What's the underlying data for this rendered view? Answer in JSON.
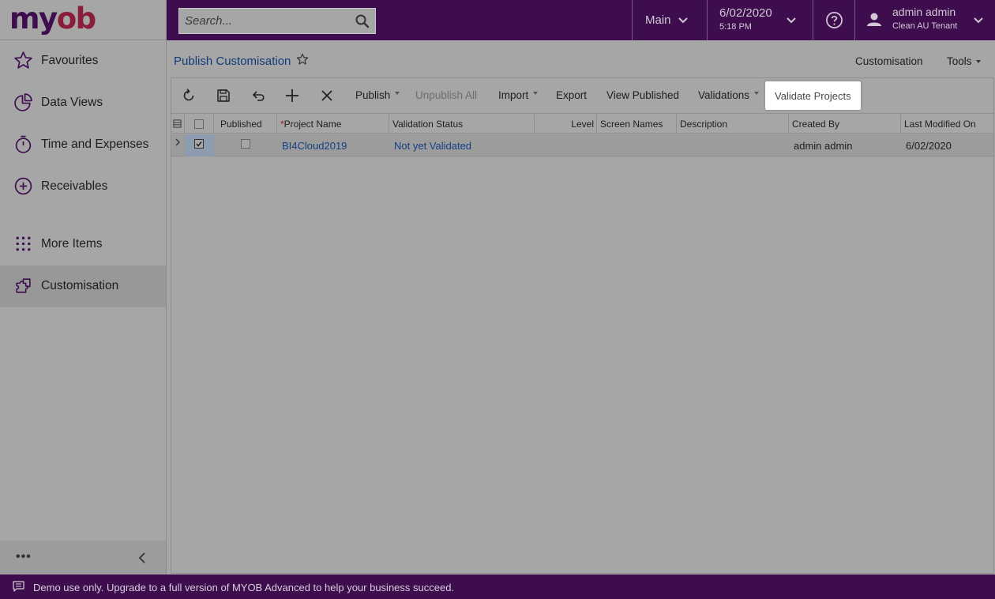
{
  "brand": {
    "logo_text": "myob"
  },
  "topbar": {
    "search_placeholder": "Search...",
    "main_label": "Main",
    "date": "6/02/2020",
    "time": "5:18 PM",
    "user_name": "admin admin",
    "tenant": "Clean AU Tenant",
    "bg_color": "#3d0d4e"
  },
  "sidebar": {
    "items": [
      {
        "label": "Favourites",
        "icon": "star-icon"
      },
      {
        "label": "Data Views",
        "icon": "pie-chart-icon"
      },
      {
        "label": "Time and Expenses",
        "icon": "stopwatch-icon"
      },
      {
        "label": "Receivables",
        "icon": "plus-circle-icon"
      },
      {
        "label": "More Items",
        "icon": "grid-dots-icon"
      },
      {
        "label": "Customisation",
        "icon": "puzzle-icon",
        "active": true
      }
    ],
    "footer_more": "•••"
  },
  "page": {
    "title": "Publish Customisation",
    "links": {
      "customisation": "Customisation",
      "tools": "Tools"
    }
  },
  "toolbar": {
    "publish": "Publish",
    "unpublish_all": "Unpublish All",
    "import": "Import",
    "export": "Export",
    "view_published": "View Published",
    "validations": "Validations",
    "validate_projects": "Validate Projects"
  },
  "grid": {
    "columns": {
      "published": "Published",
      "project_name": "Project Name",
      "validation_status": "Validation Status",
      "level": "Level",
      "screen_names": "Screen Names",
      "description": "Description",
      "created_by": "Created By",
      "last_modified_on": "Last Modified On"
    },
    "rows": [
      {
        "selected": true,
        "published": false,
        "project_name": "BI4Cloud2019",
        "validation_status": "Not yet Validated",
        "level": "",
        "screen_names": "",
        "description": "",
        "created_by": "admin admin",
        "last_modified_on": "6/02/2020"
      }
    ]
  },
  "banner": {
    "text": "Demo use only. Upgrade to a full version of MYOB Advanced to help your business succeed."
  }
}
